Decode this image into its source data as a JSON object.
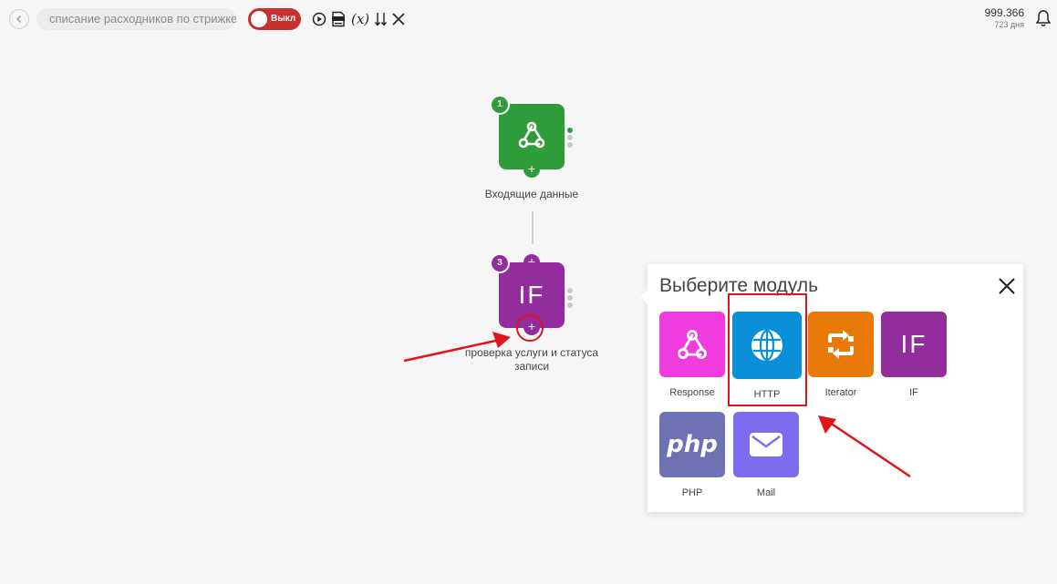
{
  "header": {
    "scenario_name": "списание расходников по стрижке",
    "toggle_label": "Выкл",
    "vars_label": "(x)",
    "operations": "999.366",
    "days_left": "723 дня"
  },
  "canvas": {
    "modules": [
      {
        "badge": "1",
        "label": "Входящие данные",
        "color": "#2e9c3a"
      },
      {
        "badge": "3",
        "label": "проверка услуги и статуса записи",
        "icon_text": "IF",
        "color": "#932c9c"
      }
    ]
  },
  "popup": {
    "title": "Выберите модуль",
    "tiles": [
      {
        "name": "Response",
        "color": "#f03bdf",
        "icon": "webhook-icon"
      },
      {
        "name": "HTTP",
        "color": "#0b8fd9",
        "icon": "globe-icon"
      },
      {
        "name": "Iterator",
        "color": "#ea7a07",
        "icon": "iterator-icon"
      },
      {
        "name": "IF",
        "icon_text": "IF",
        "color": "#932c9c"
      },
      {
        "name": "PHP",
        "icon_text": "php",
        "color": "#6e72b2"
      },
      {
        "name": "Mail",
        "color": "#7e6cf0",
        "icon": "mail-icon"
      }
    ]
  },
  "colors": {
    "annotation_red": "#e1141a",
    "toggle_red": "#c9302c"
  }
}
